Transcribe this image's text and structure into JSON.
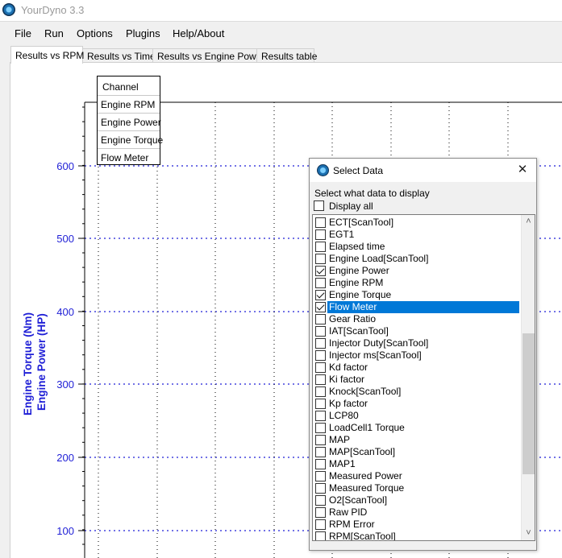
{
  "window": {
    "title": "YourDyno 3.3"
  },
  "menu": [
    "File",
    "Run",
    "Options",
    "Plugins",
    "Help/About"
  ],
  "tabs": [
    {
      "label": "Results vs RPM",
      "active": true
    },
    {
      "label": "Results vs Time",
      "active": false
    },
    {
      "label": "Results vs Engine Power",
      "active": false
    },
    {
      "label": "Results table",
      "active": false
    }
  ],
  "chart": {
    "y_axis_label_1": "Engine Torque (Nm)",
    "y_axis_label_2": "Engine Power (HP)",
    "y_ticks": [
      "600",
      "500",
      "400",
      "300",
      "200",
      "100"
    ],
    "axis_color": "#1f1fd6"
  },
  "legend": {
    "header": "Channel",
    "items": [
      "Engine RPM",
      "Engine Power",
      "Engine Torque",
      "Flow Meter"
    ]
  },
  "dialog": {
    "title": "Select Data",
    "close_glyph": "✕",
    "instruction": "Select what data to display",
    "display_all_label": "Display all",
    "display_all_checked": false,
    "scroll_up_glyph": "˄",
    "scroll_down_glyph": "˅",
    "items": [
      {
        "label": "ECT[ScanTool]",
        "checked": false
      },
      {
        "label": "EGT1",
        "checked": false
      },
      {
        "label": "Elapsed time",
        "checked": false
      },
      {
        "label": "Engine Load[ScanTool]",
        "checked": false
      },
      {
        "label": "Engine Power",
        "checked": true
      },
      {
        "label": "Engine RPM",
        "checked": false
      },
      {
        "label": "Engine Torque",
        "checked": true
      },
      {
        "label": "Flow Meter",
        "checked": true,
        "selected": true
      },
      {
        "label": "Gear Ratio",
        "checked": false
      },
      {
        "label": "IAT[ScanTool]",
        "checked": false
      },
      {
        "label": "Injector Duty[ScanTool]",
        "checked": false
      },
      {
        "label": "Injector ms[ScanTool]",
        "checked": false
      },
      {
        "label": "Kd factor",
        "checked": false
      },
      {
        "label": "Ki factor",
        "checked": false
      },
      {
        "label": "Knock[ScanTool]",
        "checked": false
      },
      {
        "label": "Kp factor",
        "checked": false
      },
      {
        "label": "LCP80",
        "checked": false
      },
      {
        "label": "LoadCell1 Torque",
        "checked": false
      },
      {
        "label": "MAP",
        "checked": false
      },
      {
        "label": "MAP[ScanTool]",
        "checked": false
      },
      {
        "label": "MAP1",
        "checked": false
      },
      {
        "label": "Measured Power",
        "checked": false
      },
      {
        "label": "Measured Torque",
        "checked": false
      },
      {
        "label": "O2[ScanTool]",
        "checked": false
      },
      {
        "label": "Raw PID",
        "checked": false
      },
      {
        "label": "RPM Error",
        "checked": false
      },
      {
        "label": "RPM[ScanTool]",
        "checked": false
      }
    ]
  }
}
